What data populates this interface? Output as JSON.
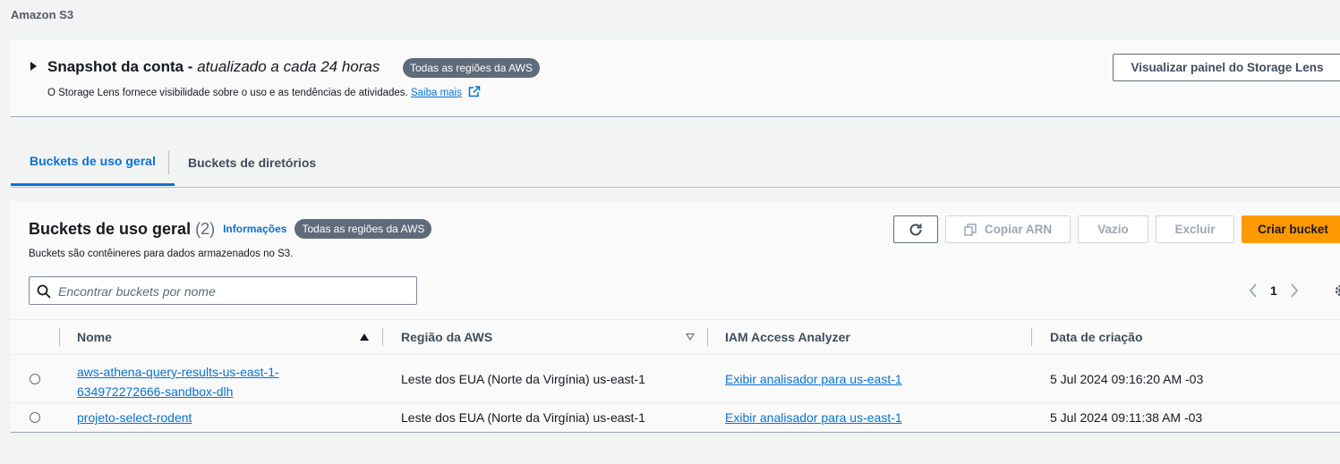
{
  "breadcrumb": "Amazon S3",
  "snapshot": {
    "title_bold": "Snapshot da conta -",
    "title_italic": "atualizado a cada 24 horas",
    "badge": "Todas as regiões da AWS",
    "description": "O Storage Lens fornece visibilidade sobre o uso e as tendências de atividades.",
    "learn_more": "Saiba mais",
    "button": "Visualizar painel do Storage Lens"
  },
  "tabs": [
    {
      "label": "Buckets de uso geral",
      "active": true
    },
    {
      "label": "Buckets de diretórios",
      "active": false
    }
  ],
  "panel": {
    "title": "Buckets de uso geral",
    "count": "(2)",
    "info": "Informações",
    "badge": "Todas as regiões da AWS",
    "description": "Buckets são contêineres para dados armazenados no S3.",
    "buttons": {
      "copy_arn": "Copiar ARN",
      "empty": "Vazio",
      "delete": "Excluir",
      "create": "Criar bucket"
    },
    "search_placeholder": "Encontrar buckets por nome",
    "page": "1"
  },
  "table": {
    "columns": [
      "Nome",
      "Região da AWS",
      "IAM Access Analyzer",
      "Data de criação"
    ],
    "rows": [
      {
        "name_line1": "aws-athena-query-results-us-east-1-",
        "name_line2": "634972272666-sandbox-dlh",
        "region": "Leste dos EUA (Norte da Virgínia) us-east-1",
        "analyzer": "Exibir analisador para us-east-1",
        "created": "5 Jul 2024 09:16:20 AM -03"
      },
      {
        "name": "projeto-select-rodent",
        "region": "Leste dos EUA (Norte da Virgínia) us-east-1",
        "analyzer": "Exibir analisador para us-east-1",
        "created": "5 Jul 2024 09:11:38 AM -03"
      }
    ]
  },
  "colors": {
    "accent": "#0972d3",
    "primary_button": "#ff9900",
    "badge": "#5f6b7a"
  }
}
